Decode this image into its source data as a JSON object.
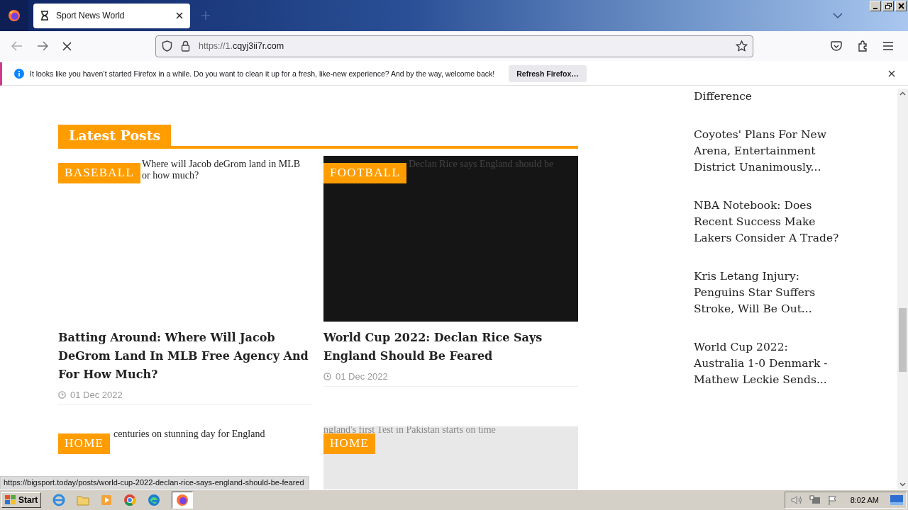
{
  "browser": {
    "tab": {
      "title": "Sport News World",
      "selected": true
    },
    "url": {
      "scheme": "https://1.",
      "host": "cqyj3ii7r.com"
    }
  },
  "notification": {
    "message": "It looks like you haven’t started Firefox in a while. Do you want to clean it up for a fresh, like-new experience? And by the way, welcome back!",
    "button": "Refresh Firefox…"
  },
  "latest_posts": {
    "heading": "Latest Posts",
    "posts": [
      {
        "category": "BASEBALL",
        "kind": "blank",
        "alt_lines": [
          "Where will Jacob deGrom land in MLB",
          "or how much?"
        ],
        "title": "Batting Around: Where Will Jacob DeGrom Land In MLB Free Agency And For How Much?",
        "date": "01 Dec 2022"
      },
      {
        "category": "FOOTBALL",
        "kind": "dark",
        "alt_lines": [
          "Declan Rice says England should be"
        ],
        "title": "World Cup 2022: Declan Rice Says England Should Be Feared",
        "date": "01 Dec 2022"
      },
      {
        "category": "HOME",
        "kind": "blank",
        "alt_lines": [
          "centuries on stunning day for England"
        ]
      },
      {
        "category": "HOME",
        "kind": "light",
        "alt_lines": [
          "ngland's first Test in Pakistan starts on time"
        ]
      }
    ]
  },
  "sidebar": {
    "items": [
      "Difference",
      "Coyotes' Plans For New Arena, Entertainment District Unanimously...",
      "NBA Notebook: Does Recent Success Make Lakers Consider A Trade?",
      "Kris Letang Injury: Penguins Star Suffers Stroke, Will Be Out...",
      "World Cup 2022: Australia 1-0 Denmark - Mathew Leckie Sends..."
    ]
  },
  "status_link": "https://bigsport.today/posts/world-cup-2022-declan-rice-says-england-should-be-feared",
  "taskbar": {
    "start": "Start",
    "clock": "8:02 AM"
  }
}
